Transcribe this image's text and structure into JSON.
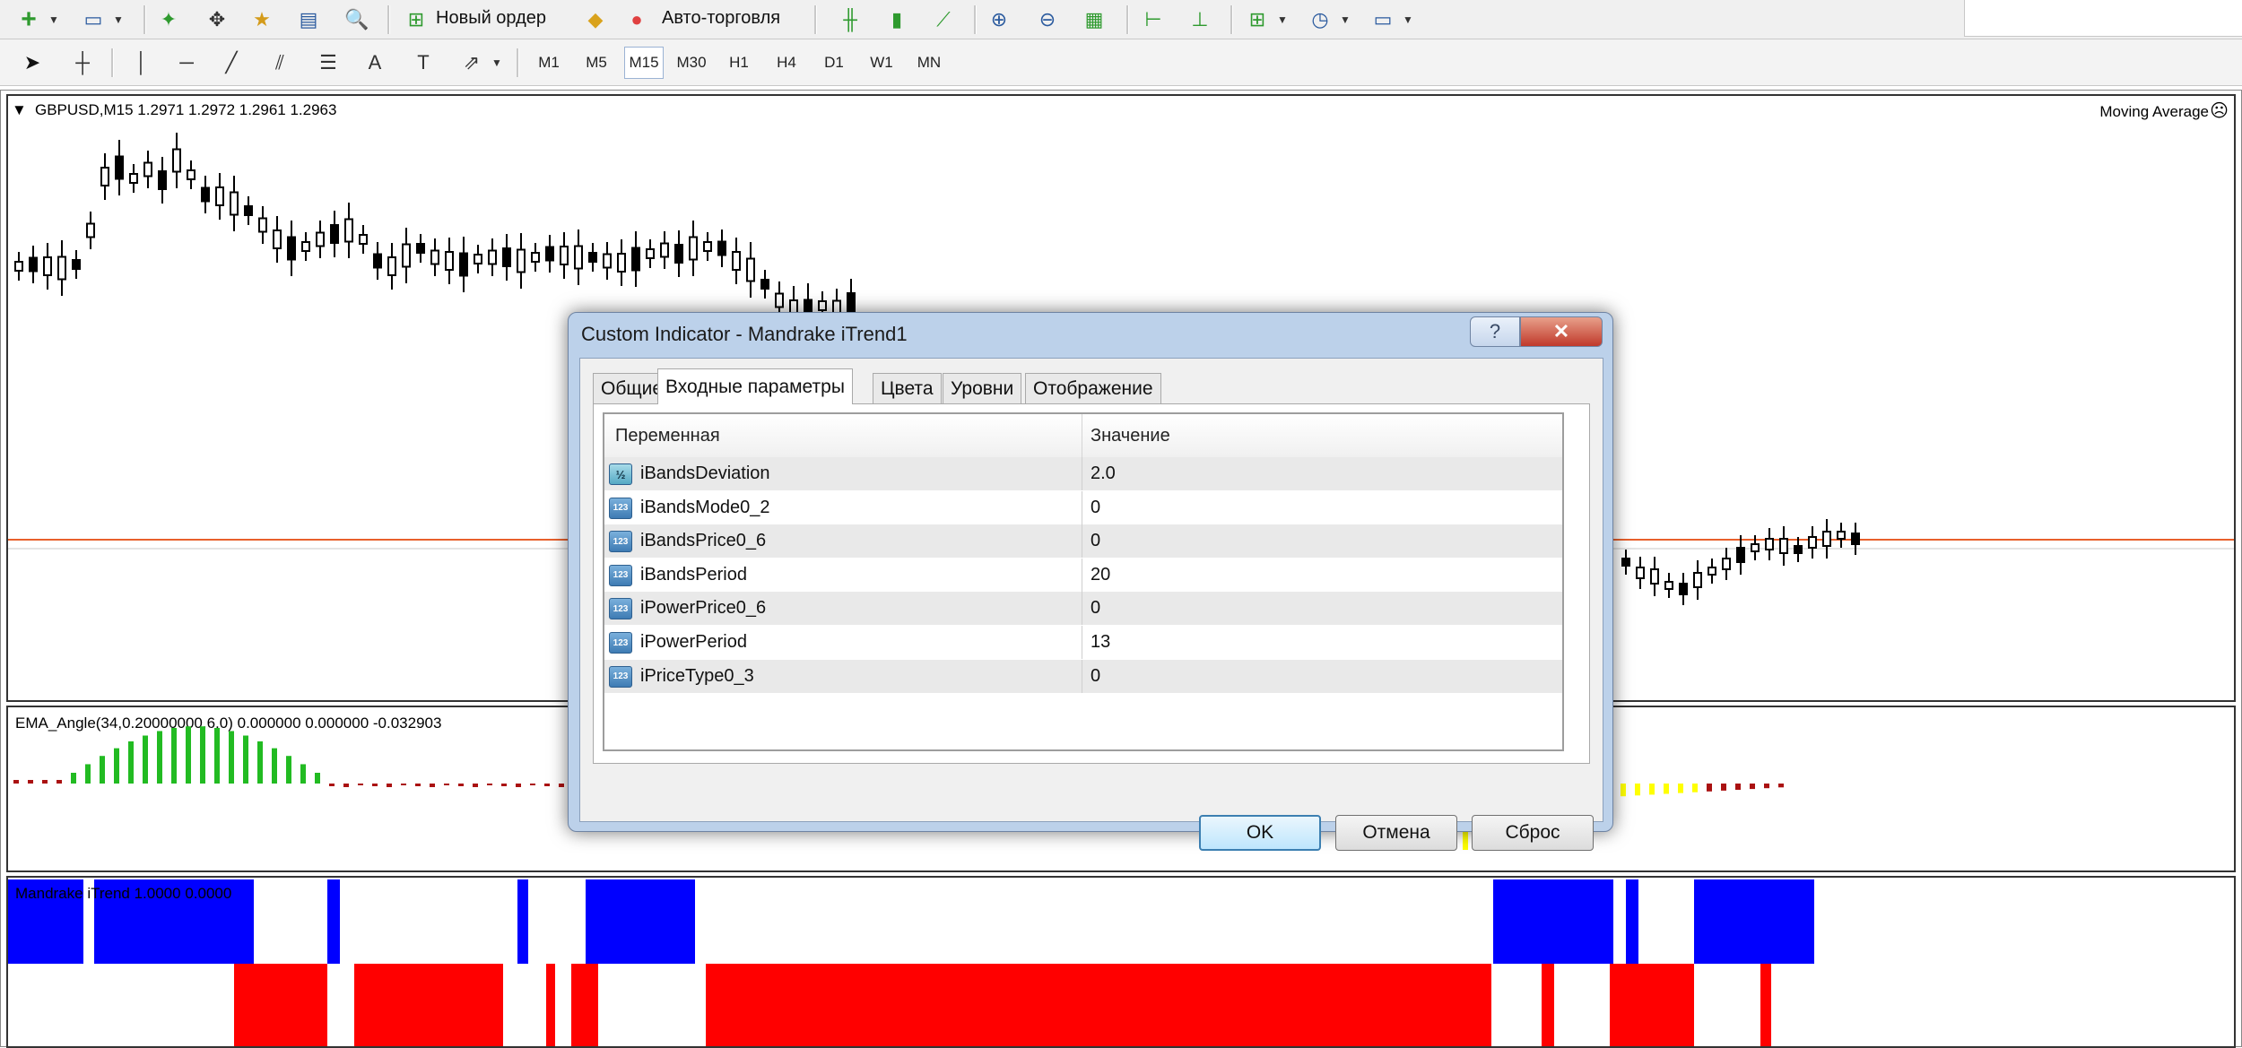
{
  "toolbar": {
    "new_order_label": "Новый ордер",
    "auto_trading_label": "Авто-торговля",
    "timeframes": [
      "M1",
      "M5",
      "M15",
      "M30",
      "H1",
      "H4",
      "D1",
      "W1",
      "MN"
    ],
    "active_timeframe": "M15",
    "draw_text_tool": "A"
  },
  "chart": {
    "header": "GBPUSD,M15  1.2971 1.2972 1.2961 1.2963",
    "indicator_name": "Moving Average",
    "ema_label": "EMA_Angle(34,0.20000000,6,0) 0.000000 0.000000 -0.032903",
    "mtrend_label": "Mandrake iTrend 1.0000 0.0000",
    "colors": {
      "up": "#0000ff",
      "down": "#ff0000",
      "ema_up": "#22bb22",
      "ema_flat": "#aa1111",
      "ema_down": "#ffff00",
      "ma_line": "#e8602c"
    }
  },
  "dialog": {
    "title": "Custom Indicator - Mandrake iTrend1",
    "help_button": "?",
    "close_button": "✕",
    "tabs": [
      "Общие",
      "Входные параметры",
      "Цвета",
      "Уровни",
      "Отображение"
    ],
    "active_tab": "Входные параметры",
    "columns": {
      "name": "Переменная",
      "value": "Значение"
    },
    "params": [
      {
        "icon": "½",
        "type": "double",
        "name": "iBandsDeviation",
        "value": "2.0"
      },
      {
        "icon": "123",
        "type": "int",
        "name": "iBandsMode0_2",
        "value": "0"
      },
      {
        "icon": "123",
        "type": "int",
        "name": "iBandsPrice0_6",
        "value": "0"
      },
      {
        "icon": "123",
        "type": "int",
        "name": "iBandsPeriod",
        "value": "20"
      },
      {
        "icon": "123",
        "type": "int",
        "name": "iPowerPrice0_6",
        "value": "0"
      },
      {
        "icon": "123",
        "type": "int",
        "name": "iPowerPeriod",
        "value": "13"
      },
      {
        "icon": "123",
        "type": "int",
        "name": "iPriceType0_3",
        "value": "0"
      }
    ],
    "buttons": {
      "ok": "OK",
      "cancel": "Отмена",
      "reset": "Сброс"
    }
  }
}
